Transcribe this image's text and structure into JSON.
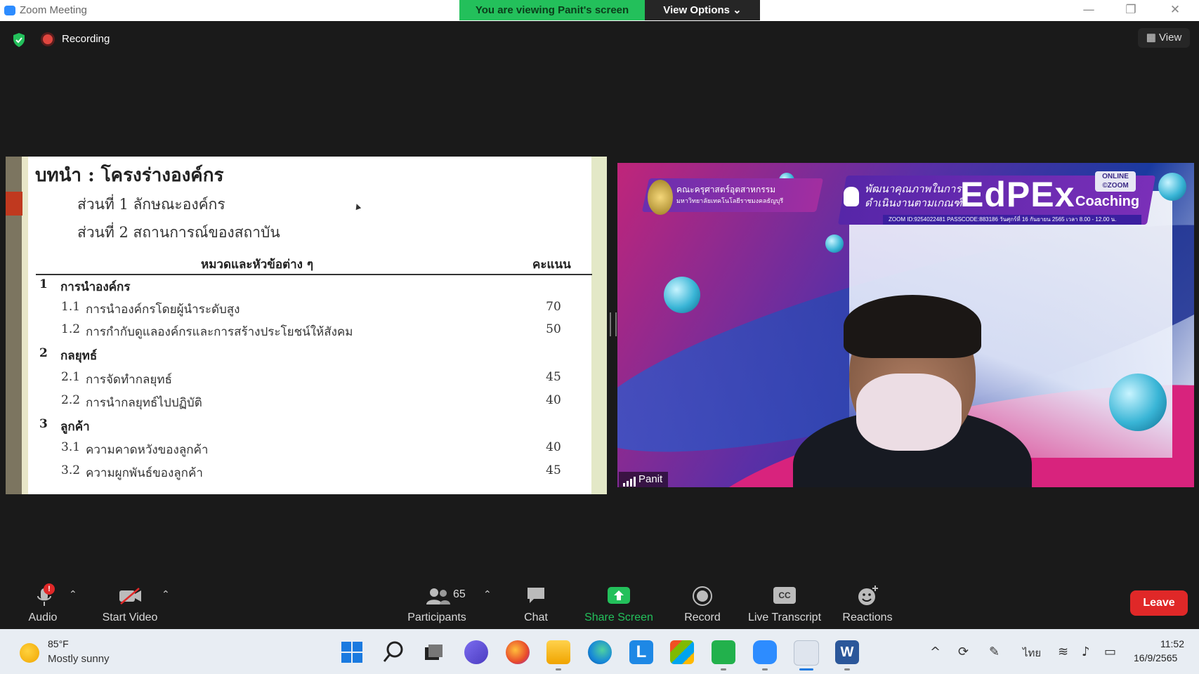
{
  "window": {
    "title": "Zoom Meeting",
    "minimize": "—",
    "restore": "❐",
    "close": "✕"
  },
  "banner": {
    "viewing": "You are viewing Panit's screen",
    "view_options": "View Options ⌄"
  },
  "status": {
    "recording": "Recording",
    "view": "View"
  },
  "slide": {
    "title": "บทนำ : โครงร่างองค์กร",
    "part1": "ส่วนที่ 1  ลักษณะองค์กร",
    "part2": "ส่วนที่ 2  สถานการณ์ของสถาบัน",
    "col_category": "หมวดและหัวข้อต่าง ๆ",
    "col_score": "คะแนน",
    "rows": [
      {
        "num": "1",
        "text": "การนำองค์กร",
        "score": ""
      },
      {
        "num": "1.1",
        "text": "การนำองค์กรโดยผู้นำระดับสูง",
        "score": "70"
      },
      {
        "num": "1.2",
        "text": "การกำกับดูแลองค์กรและการสร้างประโยชน์ให้สังคม",
        "score": "50"
      },
      {
        "num": "2",
        "text": "กลยุทธ์",
        "score": ""
      },
      {
        "num": "2.1",
        "text": "การจัดทำกลยุทธ์",
        "score": "45"
      },
      {
        "num": "2.2",
        "text": "การนำกลยุทธ์ไปปฏิบัติ",
        "score": "40"
      },
      {
        "num": "3",
        "text": "ลูกค้า",
        "score": ""
      },
      {
        "num": "3.1",
        "text": "ความคาดหวังของลูกค้า",
        "score": "40"
      },
      {
        "num": "3.2",
        "text": "ความผูกพันธ์ของลูกค้า",
        "score": "45"
      }
    ]
  },
  "video": {
    "participant_name": "Panit",
    "banner_left": "คณะครุศาสตร์อุตสาหกรรม",
    "banner_left_sub": "มหาวิทยาลัยเทคโนโลยีราชมงคลธัญบุรี",
    "banner_thai_1": "พัฒนาคุณภาพในการ",
    "banner_thai_2": "ดำเนินงานตามเกณฑ์",
    "edpex": "EdPEx",
    "coaching": "Coaching",
    "online_badge_1": "ONLINE",
    "online_badge_2": "©ZOOM",
    "zoom_id": "ZOOM ID:9254022481 PASSCODE:883186  วันศุกร์ที่ 16 กันยายน 2565 เวลา 8.00 - 12.00 น."
  },
  "toolbar": {
    "audio": "Audio",
    "start_video": "Start Video",
    "participants": "Participants",
    "participants_count": "65",
    "chat": "Chat",
    "share_screen": "Share Screen",
    "record": "Record",
    "live_transcript": "Live Transcript",
    "reactions": "Reactions",
    "leave": "Leave",
    "audio_alert": "!",
    "cc": "CC"
  },
  "taskbar": {
    "temperature": "85°F",
    "weather": "Mostly sunny",
    "time": "11:52",
    "date": "16/9/2565",
    "language": "ไทย",
    "chevron": "^"
  },
  "colors": {
    "share_green": "#23c05b",
    "leave_red": "#e02828",
    "zoom_blue": "#2d8cff"
  }
}
